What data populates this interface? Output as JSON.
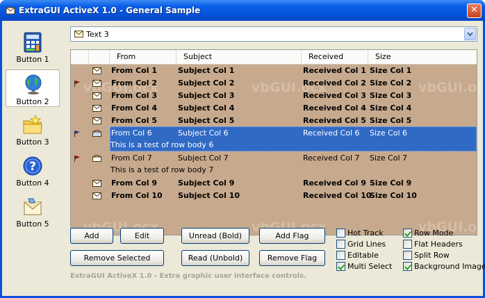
{
  "window": {
    "title": "ExtraGUI ActiveX 1.0 - General Sample",
    "close_label": "✕"
  },
  "sidebar": {
    "items": [
      {
        "label": "Button 1",
        "icon": "calculator-icon"
      },
      {
        "label": "Button 2",
        "icon": "globe-icon",
        "selected": true
      },
      {
        "label": "Button 3",
        "icon": "folder-star-icon"
      },
      {
        "label": "Button 4",
        "icon": "help-icon"
      },
      {
        "label": "Button 5",
        "icon": "mail-icon"
      }
    ]
  },
  "combo": {
    "value": "Text 3"
  },
  "grid": {
    "headers": [
      "From",
      "Subject",
      "Received",
      "Size"
    ],
    "watermark": "vbGUI.ocx",
    "rows": [
      {
        "from": "From Col 1",
        "subject": "Subject Col 1",
        "received": "Received Col 1",
        "size": "Size Col 1",
        "bold": true,
        "flag": false,
        "body": ""
      },
      {
        "from": "From Col 2",
        "subject": "Subject Col 2",
        "received": "Received Col 2",
        "size": "Size Col 2",
        "bold": true,
        "flag": true,
        "body": ""
      },
      {
        "from": "From Col 3",
        "subject": "Subject Col 3",
        "received": "Received Col 3",
        "size": "Size Col 3",
        "bold": true,
        "flag": false,
        "body": ""
      },
      {
        "from": "From Col 4",
        "subject": "Subject Col 4",
        "received": "Received Col 4",
        "size": "Size Col 4",
        "bold": true,
        "flag": false,
        "body": ""
      },
      {
        "from": "From Col 5",
        "subject": "Subject Col 5",
        "received": "Received Col 5",
        "size": "Size Col 5",
        "bold": true,
        "flag": false,
        "body": ""
      },
      {
        "from": "From Col 6",
        "subject": "Subject Col 6",
        "received": "Received Col 6",
        "size": "Size Col 6",
        "bold": false,
        "flag": true,
        "selected": true,
        "body": "This is a test of row body 6"
      },
      {
        "from": "From Col 7",
        "subject": "Subject Col 7",
        "received": "Received Col 7",
        "size": "Size Col 7",
        "bold": false,
        "flag": true,
        "body": "This is a test of row body 7"
      },
      {
        "from": "From Col 9",
        "subject": "Subject Col 9",
        "received": "Received Col 9",
        "size": "Size Col 9",
        "bold": true,
        "flag": false,
        "body": ""
      },
      {
        "from": "From Col 10",
        "subject": "Subject Col 10",
        "received": "Received Col 10",
        "size": "Size Col 10",
        "bold": true,
        "flag": false,
        "body": ""
      }
    ]
  },
  "buttons": {
    "add": "Add",
    "edit": "Edit",
    "unread": "Unread (Bold)",
    "add_flag": "Add Flag",
    "remove_selected": "Remove Selected",
    "read": "Read (Unbold)",
    "remove_flag": "Remove Flag"
  },
  "options": {
    "hot_track": {
      "label": "Hot Track",
      "checked": false
    },
    "grid_lines": {
      "label": "Grid Lines",
      "checked": false
    },
    "editable": {
      "label": "Editable",
      "checked": false
    },
    "multi_select": {
      "label": "Multi Select",
      "checked": true
    },
    "row_mode": {
      "label": "Row Mode",
      "checked": true
    },
    "flat_headers": {
      "label": "Flat Headers",
      "checked": false
    },
    "split_row": {
      "label": "Split Row",
      "checked": false
    },
    "background_image": {
      "label": "Background Image",
      "checked": true
    }
  },
  "footer": "ExtraGUI ActiveX 1.0 - Extra graphic user interface controls.",
  "colors": {
    "grid_bg": "#c7aa8e",
    "selection": "#316ac5",
    "title_bar": "#0553d8"
  }
}
